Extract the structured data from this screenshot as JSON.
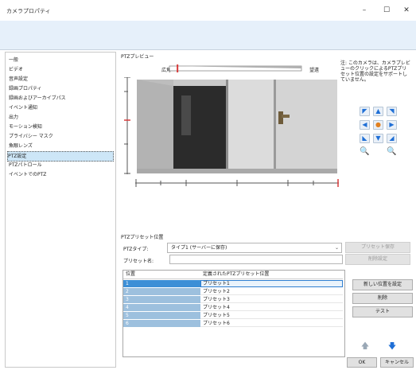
{
  "window": {
    "title": "カメラプロパティ",
    "minimize_glyph": "–",
    "maximize_glyph": "☐",
    "close_glyph": "✕"
  },
  "sidebar": {
    "items": [
      {
        "label": "一般",
        "selected": false
      },
      {
        "label": "ビデオ",
        "selected": false
      },
      {
        "label": "音声設定",
        "selected": false
      },
      {
        "label": "録画プロパティ",
        "selected": false
      },
      {
        "label": "録画およびアーカイブパス",
        "selected": false
      },
      {
        "label": "イベント通知",
        "selected": false
      },
      {
        "label": "出力",
        "selected": false
      },
      {
        "label": "モーション検知",
        "selected": false
      },
      {
        "label": "プライバシー マスク",
        "selected": false
      },
      {
        "label": "魚眼レンズ",
        "selected": false
      },
      {
        "label": "PTZ設定",
        "selected": true
      },
      {
        "label": "PTZパトロール",
        "selected": false
      },
      {
        "label": "イベントでのPTZ",
        "selected": false
      }
    ]
  },
  "ptz_view": {
    "section_label": "PTZプレビュー",
    "zoom_wide_label": "広角",
    "zoom_tele_label": "望遠",
    "zoom_level": 0.05,
    "note": "注: このカメラは、カメラプレビューのクリックによるPTZプリセット位置の設定をサポートしていません。"
  },
  "preset_section": {
    "section_label": "PTZプリセット位置",
    "ptz_type_label": "PTZタイプ:",
    "ptz_type_value": "タイプ1 (サーバーに保存)",
    "preset_name_label": "プリセット名:",
    "preset_name_value": "",
    "set_preset_button": "プリセット保存",
    "delete_setting_button": "削除設定",
    "table": {
      "col_position": "位置",
      "col_defined": "定義されたPTZプリセット位置",
      "rows": [
        {
          "position": "1",
          "name": "プリセット1",
          "selected": true
        },
        {
          "position": "2",
          "name": "プリセット2",
          "selected": false
        },
        {
          "position": "3",
          "name": "プリセット3",
          "selected": false
        },
        {
          "position": "4",
          "name": "プリセット4",
          "selected": false
        },
        {
          "position": "5",
          "name": "プリセット5",
          "selected": false
        },
        {
          "position": "6",
          "name": "プリセット6",
          "selected": false
        }
      ]
    },
    "new_position_button": "新しい位置を設定",
    "delete_button": "削除",
    "test_button": "テスト",
    "move_up_glyph": "🡅",
    "move_down_glyph": "🡇"
  },
  "footer": {
    "ok_button": "OK",
    "cancel_button": "キャンセル"
  },
  "colors": {
    "accent": "#1f6fd6",
    "header_band": "#e6f0fa",
    "selection": "#cde6f7",
    "position_cell": "#9dc0de"
  }
}
